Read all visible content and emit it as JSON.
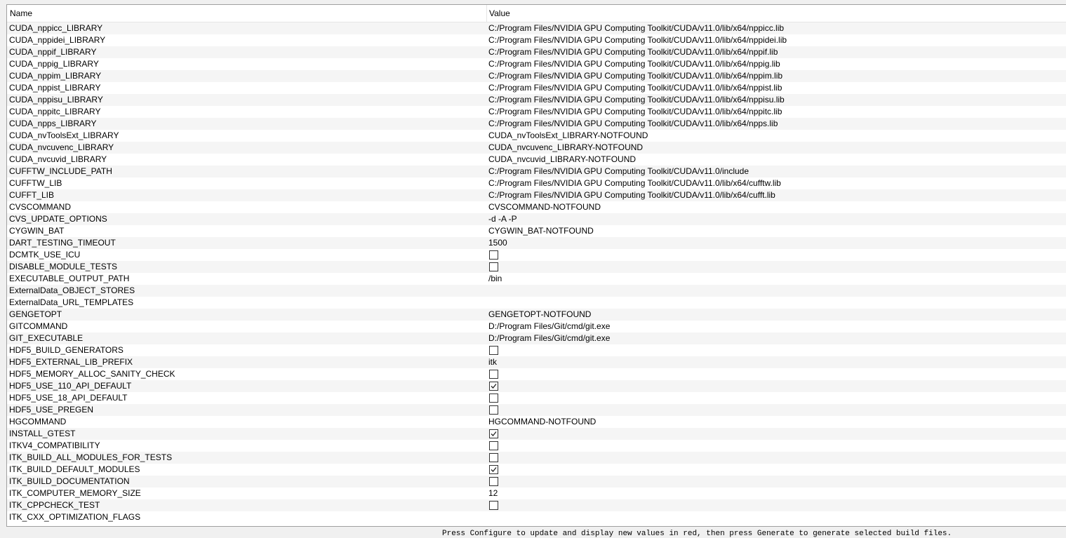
{
  "table": {
    "header": {
      "name": "Name",
      "value": "Value"
    },
    "rows": [
      {
        "name": "CUDA_nppicc_LIBRARY",
        "type": "text",
        "value": "C:/Program Files/NVIDIA GPU Computing Toolkit/CUDA/v11.0/lib/x64/nppicc.lib"
      },
      {
        "name": "CUDA_nppidei_LIBRARY",
        "type": "text",
        "value": "C:/Program Files/NVIDIA GPU Computing Toolkit/CUDA/v11.0/lib/x64/nppidei.lib"
      },
      {
        "name": "CUDA_nppif_LIBRARY",
        "type": "text",
        "value": "C:/Program Files/NVIDIA GPU Computing Toolkit/CUDA/v11.0/lib/x64/nppif.lib"
      },
      {
        "name": "CUDA_nppig_LIBRARY",
        "type": "text",
        "value": "C:/Program Files/NVIDIA GPU Computing Toolkit/CUDA/v11.0/lib/x64/nppig.lib"
      },
      {
        "name": "CUDA_nppim_LIBRARY",
        "type": "text",
        "value": "C:/Program Files/NVIDIA GPU Computing Toolkit/CUDA/v11.0/lib/x64/nppim.lib"
      },
      {
        "name": "CUDA_nppist_LIBRARY",
        "type": "text",
        "value": "C:/Program Files/NVIDIA GPU Computing Toolkit/CUDA/v11.0/lib/x64/nppist.lib"
      },
      {
        "name": "CUDA_nppisu_LIBRARY",
        "type": "text",
        "value": "C:/Program Files/NVIDIA GPU Computing Toolkit/CUDA/v11.0/lib/x64/nppisu.lib"
      },
      {
        "name": "CUDA_nppitc_LIBRARY",
        "type": "text",
        "value": "C:/Program Files/NVIDIA GPU Computing Toolkit/CUDA/v11.0/lib/x64/nppitc.lib"
      },
      {
        "name": "CUDA_npps_LIBRARY",
        "type": "text",
        "value": "C:/Program Files/NVIDIA GPU Computing Toolkit/CUDA/v11.0/lib/x64/npps.lib"
      },
      {
        "name": "CUDA_nvToolsExt_LIBRARY",
        "type": "text",
        "value": "CUDA_nvToolsExt_LIBRARY-NOTFOUND"
      },
      {
        "name": "CUDA_nvcuvenc_LIBRARY",
        "type": "text",
        "value": "CUDA_nvcuvenc_LIBRARY-NOTFOUND"
      },
      {
        "name": "CUDA_nvcuvid_LIBRARY",
        "type": "text",
        "value": "CUDA_nvcuvid_LIBRARY-NOTFOUND"
      },
      {
        "name": "CUFFTW_INCLUDE_PATH",
        "type": "text",
        "value": "C:/Program Files/NVIDIA GPU Computing Toolkit/CUDA/v11.0/include"
      },
      {
        "name": "CUFFTW_LIB",
        "type": "text",
        "value": "C:/Program Files/NVIDIA GPU Computing Toolkit/CUDA/v11.0/lib/x64/cufftw.lib"
      },
      {
        "name": "CUFFT_LIB",
        "type": "text",
        "value": "C:/Program Files/NVIDIA GPU Computing Toolkit/CUDA/v11.0/lib/x64/cufft.lib"
      },
      {
        "name": "CVSCOMMAND",
        "type": "text",
        "value": "CVSCOMMAND-NOTFOUND"
      },
      {
        "name": "CVS_UPDATE_OPTIONS",
        "type": "text",
        "value": "-d -A -P"
      },
      {
        "name": "CYGWIN_BAT",
        "type": "text",
        "value": "CYGWIN_BAT-NOTFOUND"
      },
      {
        "name": "DART_TESTING_TIMEOUT",
        "type": "text",
        "value": "1500"
      },
      {
        "name": "DCMTK_USE_ICU",
        "type": "bool",
        "checked": false
      },
      {
        "name": "DISABLE_MODULE_TESTS",
        "type": "bool",
        "checked": false
      },
      {
        "name": "EXECUTABLE_OUTPUT_PATH",
        "type": "text",
        "value": "/bin"
      },
      {
        "name": "ExternalData_OBJECT_STORES",
        "type": "text",
        "value": ""
      },
      {
        "name": "ExternalData_URL_TEMPLATES",
        "type": "text",
        "value": ""
      },
      {
        "name": "GENGETOPT",
        "type": "text",
        "value": "GENGETOPT-NOTFOUND"
      },
      {
        "name": "GITCOMMAND",
        "type": "text",
        "value": "D:/Program Files/Git/cmd/git.exe"
      },
      {
        "name": "GIT_EXECUTABLE",
        "type": "text",
        "value": "D:/Program Files/Git/cmd/git.exe"
      },
      {
        "name": "HDF5_BUILD_GENERATORS",
        "type": "bool",
        "checked": false
      },
      {
        "name": "HDF5_EXTERNAL_LIB_PREFIX",
        "type": "text",
        "value": "itk"
      },
      {
        "name": "HDF5_MEMORY_ALLOC_SANITY_CHECK",
        "type": "bool",
        "checked": false
      },
      {
        "name": "HDF5_USE_110_API_DEFAULT",
        "type": "bool",
        "checked": true
      },
      {
        "name": "HDF5_USE_18_API_DEFAULT",
        "type": "bool",
        "checked": false
      },
      {
        "name": "HDF5_USE_PREGEN",
        "type": "bool",
        "checked": false
      },
      {
        "name": "HGCOMMAND",
        "type": "text",
        "value": "HGCOMMAND-NOTFOUND"
      },
      {
        "name": "INSTALL_GTEST",
        "type": "bool",
        "checked": true
      },
      {
        "name": "ITKV4_COMPATIBILITY",
        "type": "bool",
        "checked": false
      },
      {
        "name": "ITK_BUILD_ALL_MODULES_FOR_TESTS",
        "type": "bool",
        "checked": false
      },
      {
        "name": "ITK_BUILD_DEFAULT_MODULES",
        "type": "bool",
        "checked": true
      },
      {
        "name": "ITK_BUILD_DOCUMENTATION",
        "type": "bool",
        "checked": false
      },
      {
        "name": "ITK_COMPUTER_MEMORY_SIZE",
        "type": "text",
        "value": "12"
      },
      {
        "name": "ITK_CPPCHECK_TEST",
        "type": "bool",
        "checked": false
      },
      {
        "name": "ITK_CXX_OPTIMIZATION_FLAGS",
        "type": "text",
        "value": ""
      }
    ]
  },
  "status": {
    "text": "Press Configure to update and display new values in red, then press Generate to generate selected build files."
  }
}
